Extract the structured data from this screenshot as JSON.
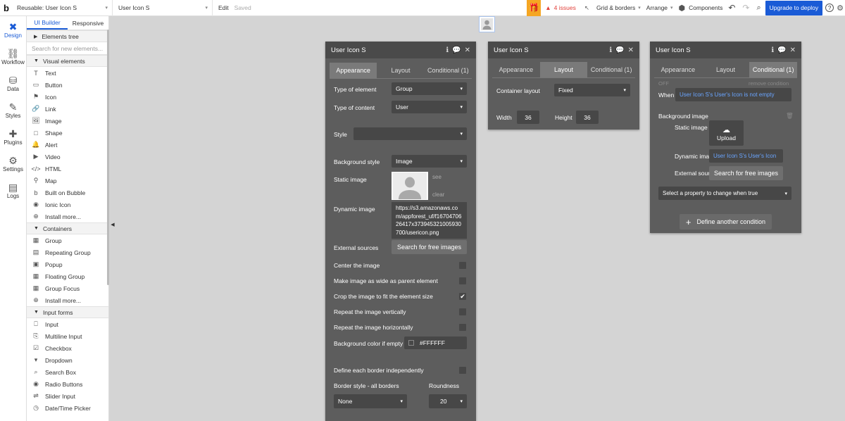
{
  "topbar": {
    "logo": "b",
    "page_select": "Reusable: User Icon S",
    "element_select": "User Icon S",
    "edit": "Edit",
    "saved": "Saved",
    "issues": "4 issues",
    "grid": "Grid & borders",
    "arrange": "Arrange",
    "components": "Components",
    "upgrade": "Upgrade to deploy",
    "help": "?",
    "brand_color": "#1a5bd6",
    "issue_color": "#e2403a"
  },
  "rail": [
    {
      "label": "Design",
      "icon": "design-icon"
    },
    {
      "label": "Workflow",
      "icon": "workflow-icon"
    },
    {
      "label": "Data",
      "icon": "data-icon"
    },
    {
      "label": "Styles",
      "icon": "styles-icon"
    },
    {
      "label": "Plugins",
      "icon": "plugins-icon"
    },
    {
      "label": "Settings",
      "icon": "settings-icon"
    },
    {
      "label": "Logs",
      "icon": "logs-icon"
    }
  ],
  "sidebar": {
    "tabs": [
      "UI Builder",
      "Responsive"
    ],
    "tree": "Elements tree",
    "search_placeholder": "Search for new elements...",
    "visual_head": "Visual elements",
    "visual": [
      "Text",
      "Button",
      "Icon",
      "Link",
      "Image",
      "Shape",
      "Alert",
      "Video",
      "HTML",
      "Map",
      "Built on Bubble",
      "Ionic Icon",
      "Install more..."
    ],
    "containers_head": "Containers",
    "containers": [
      "Group",
      "Repeating Group",
      "Popup",
      "Floating Group",
      "Group Focus",
      "Install more..."
    ],
    "inputs_head": "Input forms",
    "inputs": [
      "Input",
      "Multiline Input",
      "Checkbox",
      "Dropdown",
      "Search Box",
      "Radio Buttons",
      "Slider Input",
      "Date/Time Picker"
    ]
  },
  "panel1": {
    "title": "User Icon S",
    "tabs": [
      "Appearance",
      "Layout",
      "Conditional (1)"
    ],
    "type_label": "Type of element",
    "type_value": "Group",
    "content_label": "Type of content",
    "content_value": "User",
    "style_label": "Style",
    "bg_label": "Background style",
    "bg_value": "Image",
    "static_label": "Static image",
    "see": "see",
    "clear": "clear",
    "dynamic_label": "Dynamic image",
    "dynamic_value": "https://s3.amazonaws.com/appforest_uf/f1670470626417x37394532100593070​0/usericon.png",
    "external_label": "External sources",
    "search_btn": "Search for free images",
    "center": "Center the image",
    "wide": "Make image as wide as parent element",
    "crop": "Crop the image to fit the element size",
    "repeat_v": "Repeat the image vertically",
    "repeat_h": "Repeat the image horizontally",
    "bgcolor_label": "Background color if empty",
    "bgcolor_value": "#FFFFFF",
    "border_each": "Define each border independently",
    "border_style": "Border style - all borders",
    "roundness": "Roundness",
    "border_value": "None",
    "round_value": "20"
  },
  "panel2": {
    "title": "User Icon S",
    "tabs": [
      "Appearance",
      "Layout",
      "Conditional (1)"
    ],
    "container_label": "Container layout",
    "container_value": "Fixed",
    "width_label": "Width",
    "width_value": "36",
    "height_label": "Height",
    "height_value": "36"
  },
  "panel3": {
    "title": "User Icon S",
    "tabs": [
      "Appearance",
      "Layout",
      "Conditional (1)"
    ],
    "off": "OFF",
    "remove": "remove condition",
    "when": "When",
    "condition": "User Icon S's User's Icon is not empty",
    "bg_image": "Background image",
    "static": "Static image",
    "upload": "Upload",
    "dynamic": "Dynamic imag",
    "dynamic_value": "User Icon S's User's Icon",
    "external": "External sourc",
    "search": "Search for free images",
    "select_prop": "Select a property to change when true",
    "define": "Define another condition"
  }
}
